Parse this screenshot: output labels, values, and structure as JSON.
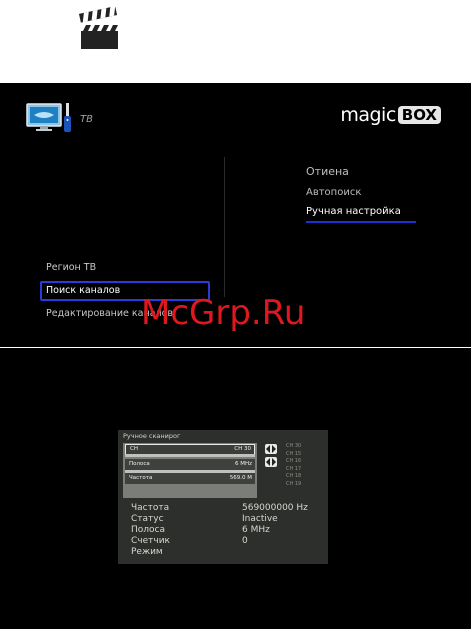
{
  "top": {
    "icon": "clapperboard-icon"
  },
  "tv_screen": {
    "app_icon": "tv-remote-icon",
    "section_label": "ТВ",
    "brand": {
      "word": "magic",
      "box": "BOX"
    },
    "right_menu": [
      {
        "label": "Отиена",
        "active": false
      },
      {
        "label": "Автопоиск",
        "active": false
      },
      {
        "label": "Ручная настройка",
        "active": true
      }
    ],
    "left_menu": [
      {
        "label": "Регион ТВ",
        "active": false
      },
      {
        "label": "Поиск каналов",
        "active": true
      },
      {
        "label": "Редактирование каналов",
        "active": false
      }
    ],
    "watermark": "McGrp.Ru"
  },
  "scan_dialog": {
    "title": "Ручное сканирог",
    "fields": [
      {
        "label": "CH",
        "value": "CH 30"
      },
      {
        "label": "Полоса",
        "value": "6 MHz"
      },
      {
        "label": "Частота",
        "value": "569.0 M"
      }
    ],
    "channel_list": [
      "CH 30",
      "CH 15",
      "CH 16",
      "CH 17",
      "CH 18",
      "CH 19"
    ],
    "info": [
      {
        "label": "Частота",
        "value": "569000000 Hz"
      },
      {
        "label": "Статус",
        "value": "Inactive"
      },
      {
        "label": "Полоса",
        "value": "6 MHz"
      },
      {
        "label": "Счетчик",
        "value": "0"
      },
      {
        "label": "Режим",
        "value": ""
      }
    ],
    "colors": {
      "background": "#2c2f2b",
      "highlight": "#e8e8e8"
    }
  }
}
